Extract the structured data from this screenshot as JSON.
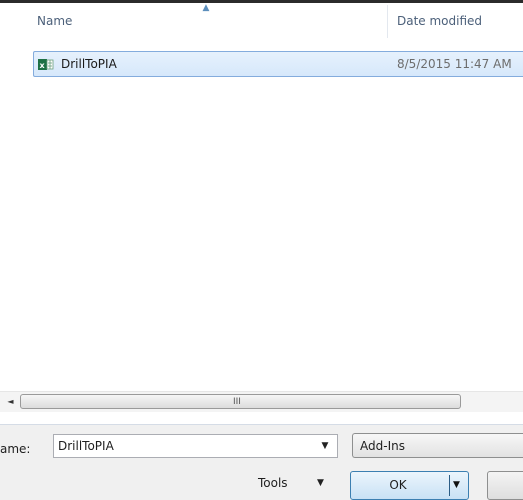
{
  "columns": {
    "name": "Name",
    "date_modified": "Date modified"
  },
  "files": [
    {
      "name": "DrillToPIA",
      "date_modified": "8/5/2015 11:47 AM",
      "icon": "excel-addin-icon"
    }
  ],
  "scrollbar": {
    "left_arrow": "◄",
    "thumb_grip": "III"
  },
  "filename": {
    "label": "ame:",
    "value": "DrillToPIA",
    "dropdown_arrow": "▼"
  },
  "filter": {
    "selected": "Add-Ins"
  },
  "buttons": {
    "tools": "Tools",
    "tools_arrow": "▼",
    "ok": "OK",
    "ok_arrow": "▼"
  },
  "colors": {
    "selection_border": "#84acdd",
    "header_text": "#4c607a",
    "excel_green": "#1e7145"
  }
}
